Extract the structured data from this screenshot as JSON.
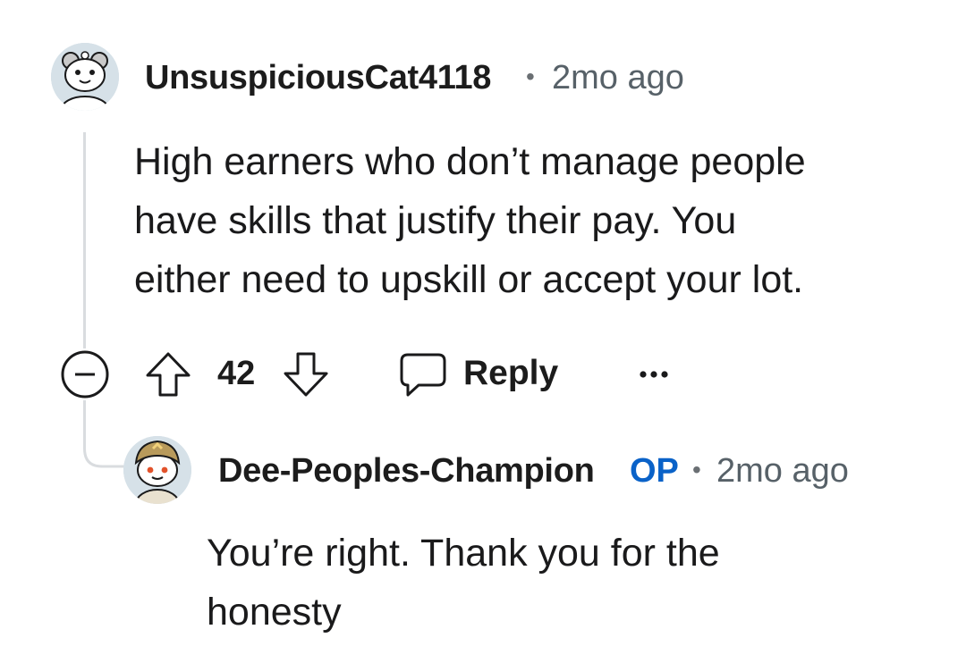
{
  "comment": {
    "author": "UnsuspiciousCat4118",
    "separator": "•",
    "time": "2mo ago",
    "body_lines": [
      "High earners who don’t manage people",
      "have skills that justify their pay. You",
      "either need to upskill or accept your lot."
    ],
    "actions": {
      "vote_count": "42",
      "reply_label": "Reply",
      "collapse_icon": "minus-circle-icon",
      "upvote_icon": "arrow-up-outline-icon",
      "downvote_icon": "arrow-down-outline-icon",
      "reply_icon": "speech-bubble-icon",
      "more_icon": "ellipsis-icon"
    }
  },
  "reply": {
    "author": "Dee-Peoples-Champion",
    "op_badge": "OP",
    "separator": "•",
    "time": "2mo ago",
    "body_lines": [
      "You’re right. Thank you for the",
      "honesty"
    ]
  },
  "colors": {
    "text": "#1a1a1b",
    "muted": "#576168",
    "op_blue": "#0a62c8",
    "thread_line": "#d9dcdf"
  }
}
